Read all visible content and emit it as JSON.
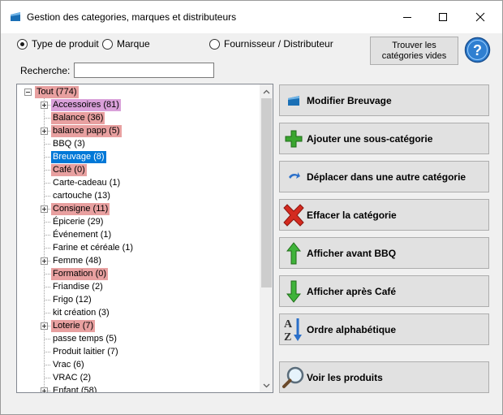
{
  "window": {
    "title": "Gestion des categories, marques et distributeurs"
  },
  "filters": {
    "options": [
      {
        "label": "Type de produit",
        "checked": true
      },
      {
        "label": "Marque",
        "checked": false
      },
      {
        "label": "Fournisseur / Distributeur",
        "checked": false
      }
    ]
  },
  "toolbar": {
    "find_empty_label_line1": "Trouver les",
    "find_empty_label_line2": "catégories vides",
    "help_icon": "question-circle-icon"
  },
  "search": {
    "label": "Recherche:",
    "value": ""
  },
  "tree": {
    "root": {
      "label": "Tout (774)",
      "highlight": "#e8a0a0"
    },
    "items": [
      {
        "label": "Accessoires (81)",
        "expander": true,
        "highlight": "#d9a0d9"
      },
      {
        "label": "Balance (36)",
        "expander": false,
        "highlight": "#e8a0a0"
      },
      {
        "label": "balance papp (5)",
        "expander": true,
        "highlight": "#e8a0a0"
      },
      {
        "label": "BBQ (3)",
        "expander": false,
        "highlight": ""
      },
      {
        "label": "Breuvage (8)",
        "expander": false,
        "highlight": "selected"
      },
      {
        "label": "Café (0)",
        "expander": false,
        "highlight": "#e8a0a0"
      },
      {
        "label": "Carte-cadeau (1)",
        "expander": false,
        "highlight": ""
      },
      {
        "label": "cartouche (13)",
        "expander": false,
        "highlight": ""
      },
      {
        "label": "Consigne (11)",
        "expander": true,
        "highlight": "#e8a0a0"
      },
      {
        "label": "Épicerie (29)",
        "expander": false,
        "highlight": ""
      },
      {
        "label": "Événement (1)",
        "expander": false,
        "highlight": ""
      },
      {
        "label": "Farine et céréale (1)",
        "expander": false,
        "highlight": ""
      },
      {
        "label": "Femme (48)",
        "expander": true,
        "highlight": ""
      },
      {
        "label": "Formation (0)",
        "expander": false,
        "highlight": "#e8a0a0"
      },
      {
        "label": "Friandise (2)",
        "expander": false,
        "highlight": ""
      },
      {
        "label": "Frigo (12)",
        "expander": false,
        "highlight": ""
      },
      {
        "label": "kit création (3)",
        "expander": false,
        "highlight": ""
      },
      {
        "label": "Loterie  (7)",
        "expander": true,
        "highlight": "#e8a0a0"
      },
      {
        "label": "passe temps (5)",
        "expander": false,
        "highlight": ""
      },
      {
        "label": "Produit laitier (7)",
        "expander": false,
        "highlight": ""
      },
      {
        "label": "Vrac (6)",
        "expander": false,
        "highlight": ""
      },
      {
        "label": "VRAC (2)",
        "expander": false,
        "highlight": ""
      },
      {
        "label": "Enfant (58)",
        "expander": true,
        "highlight": ""
      }
    ],
    "selected_color": "#0078d7"
  },
  "actions": [
    {
      "label": "Modifier Breuvage",
      "icon": "folder-edit-icon"
    },
    {
      "label": "Ajouter une sous-catégorie",
      "icon": "plus-icon"
    },
    {
      "label": "Déplacer dans une autre catégorie",
      "icon": "move-arrow-icon"
    },
    {
      "label": "Effacer la catégorie",
      "icon": "delete-x-icon"
    },
    {
      "label": "Afficher avant BBQ",
      "icon": "arrow-up-icon"
    },
    {
      "label": "Afficher après Café",
      "icon": "arrow-down-icon"
    },
    {
      "label": "Ordre alphabétique",
      "icon": "sort-az-icon"
    },
    {
      "label": "Voir les produits",
      "icon": "magnifier-icon"
    }
  ]
}
